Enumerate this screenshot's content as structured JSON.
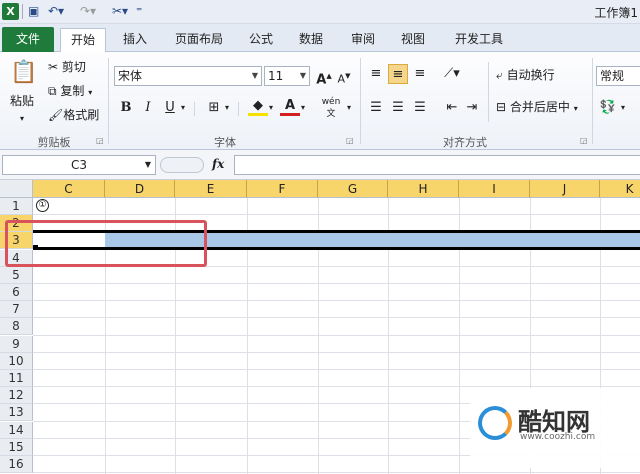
{
  "title": "工作簿1",
  "tabs": {
    "file": "文件",
    "items": [
      "开始",
      "插入",
      "页面布局",
      "公式",
      "数据",
      "审阅",
      "视图",
      "开发工具"
    ]
  },
  "clipboard": {
    "paste": "粘贴",
    "cut": "剪切",
    "copy": "复制",
    "format_painter": "格式刷",
    "label": "剪贴板"
  },
  "font": {
    "name": "宋体",
    "size": "11",
    "bold": "B",
    "italic": "I",
    "underline": "U",
    "grow": "A",
    "shrink": "A",
    "font_color": "A",
    "wen": "wén",
    "label": "字体"
  },
  "alignment": {
    "wrap": "自动换行",
    "merge": "合并后居中",
    "label": "对齐方式"
  },
  "number": {
    "format": "常规"
  },
  "formula_bar": {
    "name_box": "C3",
    "fx": "fx",
    "value": ""
  },
  "grid": {
    "columns": [
      "C",
      "D",
      "E",
      "F",
      "G",
      "H",
      "I",
      "J",
      "K"
    ],
    "rows": [
      "1",
      "2",
      "3",
      "4",
      "5",
      "6",
      "7",
      "8",
      "9",
      "10",
      "11",
      "12",
      "13",
      "14",
      "15",
      "16"
    ],
    "cell_c1": "①"
  },
  "watermark": {
    "brand": "酷知网",
    "url": "www.coozhi.com"
  },
  "colors": {
    "file_tab": "#1e7b3b",
    "header_selected": "#f8d56b",
    "selection": "#a9c8e8",
    "highlight_box": "#d9535c"
  }
}
